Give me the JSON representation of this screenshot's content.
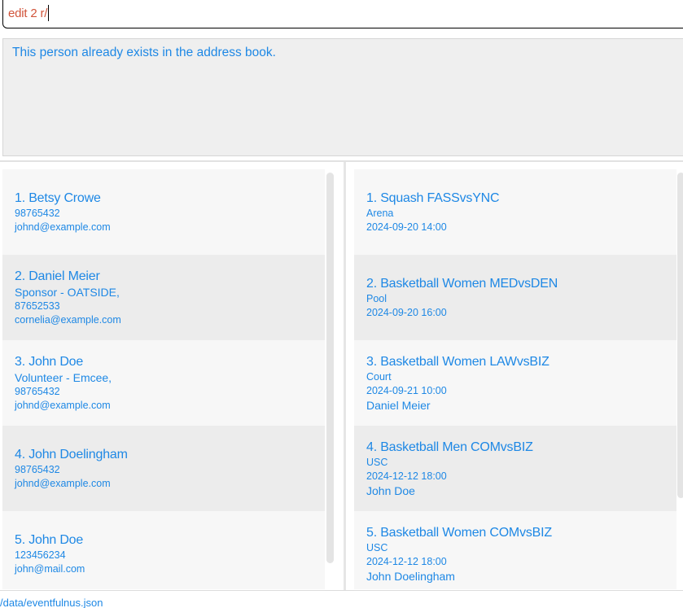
{
  "command": {
    "value": "edit 2 r/"
  },
  "result": {
    "message": "This person already exists in the address book."
  },
  "persons": [
    {
      "title": "1. Betsy Crowe",
      "lines": [
        "98765432",
        "johnd@example.com"
      ]
    },
    {
      "title": "2. Daniel Meier",
      "lines": [
        "Sponsor - OATSIDE,",
        "87652533",
        "cornelia@example.com"
      ]
    },
    {
      "title": "3. John Doe",
      "lines": [
        "Volunteer - Emcee,",
        "98765432",
        "johnd@example.com"
      ]
    },
    {
      "title": "4. John Doelingham",
      "lines": [
        "98765432",
        "johnd@example.com"
      ]
    },
    {
      "title": "5. John Doe",
      "lines": [
        "123456234",
        "john@mail.com"
      ]
    }
  ],
  "events": [
    {
      "title": "1. Squash FASSvsYNC",
      "venue": "Arena",
      "time": "2024-09-20 14:00",
      "participant": ""
    },
    {
      "title": "2. Basketball Women MEDvsDEN",
      "venue": "Pool",
      "time": "2024-09-20 16:00",
      "participant": ""
    },
    {
      "title": "3. Basketball Women LAWvsBIZ",
      "venue": "Court",
      "time": "2024-09-21 10:00",
      "participant": "Daniel Meier"
    },
    {
      "title": "4. Basketball Men COMvsBIZ",
      "venue": "USC",
      "time": "2024-12-12 18:00",
      "participant": "John Doe"
    },
    {
      "title": "5. Basketball Women COMvsBIZ",
      "venue": "USC",
      "time": "2024-12-12 18:00",
      "participant": "John Doelingham"
    }
  ],
  "status": {
    "path": "/data/eventfulnus.json"
  }
}
